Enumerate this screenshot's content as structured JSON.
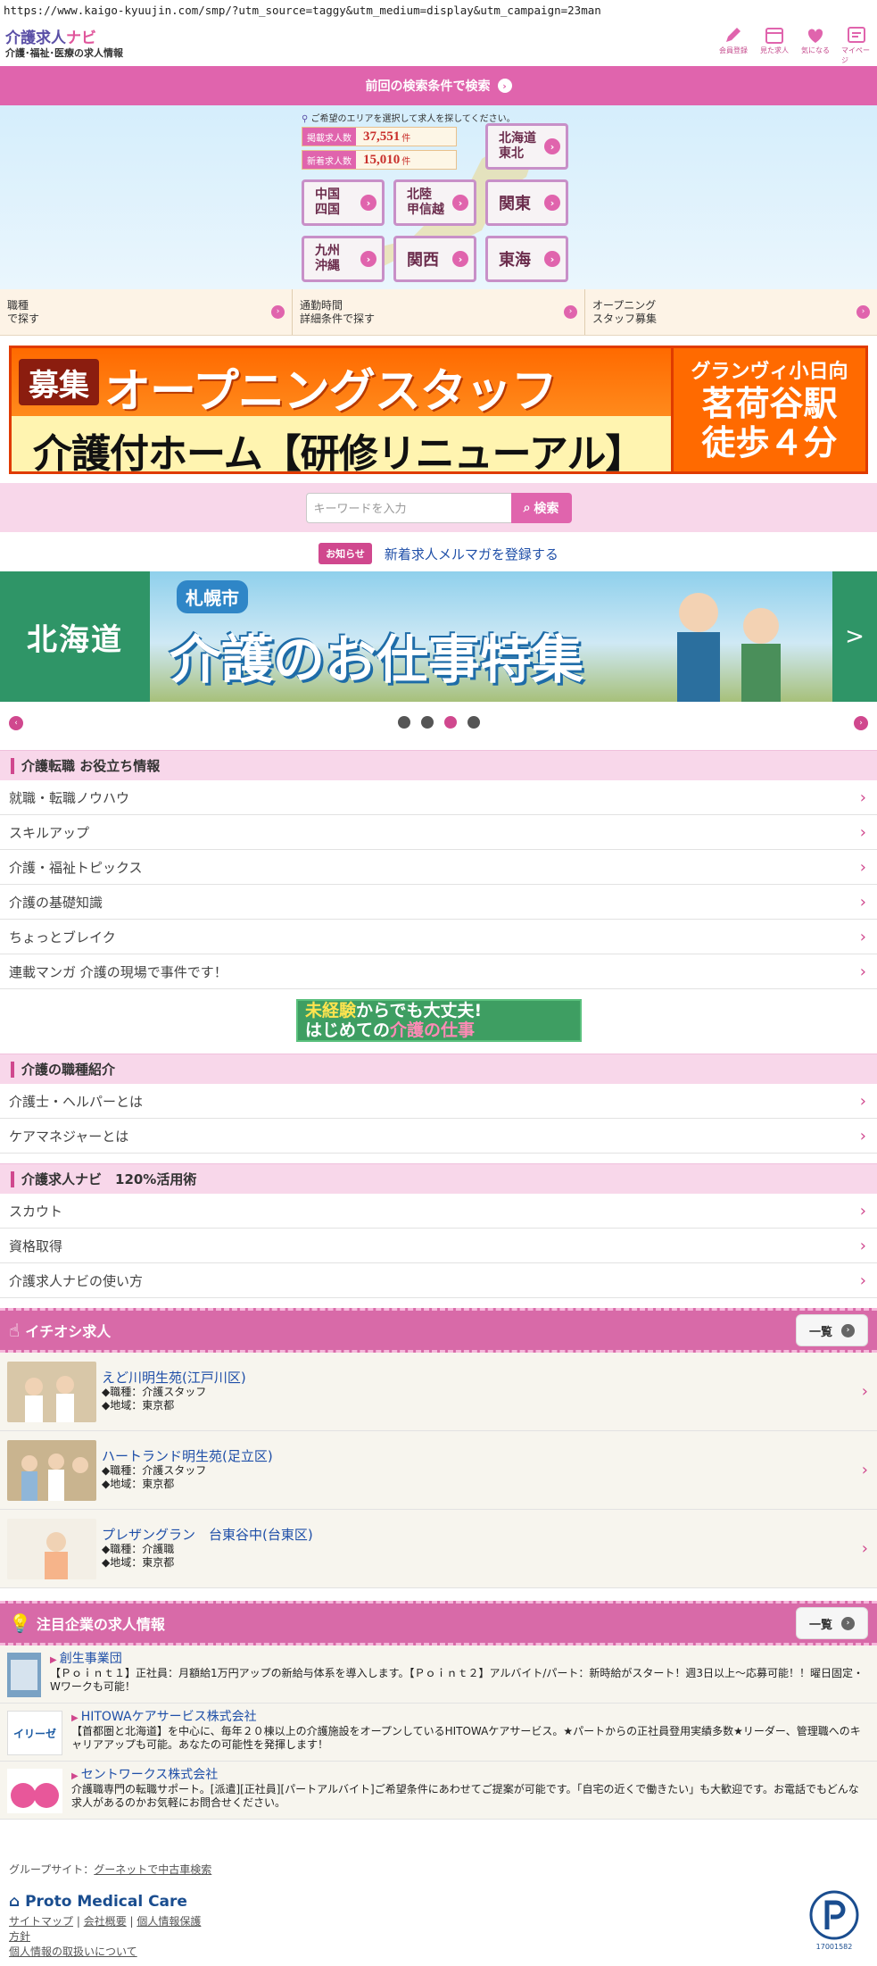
{
  "url": "https://www.kaigo-kyuujin.com/smp/?utm_source=taggy&utm_medium=display&utm_campaign=23man",
  "header": {
    "logo_title_a": "介護求人",
    "logo_title_b": "ナビ",
    "logo_sub": "介護･福祉･医療の求人情報",
    "icons": [
      {
        "name": "pencil-icon",
        "label": "会員登録"
      },
      {
        "name": "calendar-icon",
        "label": "見た求人"
      },
      {
        "name": "heart-icon",
        "label": "気になる"
      },
      {
        "name": "mypage-icon",
        "label": "マイページ"
      }
    ]
  },
  "last_search": "前回の検索条件で検索",
  "region": {
    "hint": "ご希望のエリアを選択して求人を探してください。",
    "stat1_label": "掲載求人数",
    "stat1_value": "37,551",
    "stat1_unit": "件",
    "stat2_label": "新着求人数",
    "stat2_value": "15,010",
    "stat2_unit": "件",
    "buttons": [
      "北海道\n東北",
      "中国\n四国",
      "北陸\n甲信越",
      "関東",
      "九州\n沖縄",
      "関西",
      "東海"
    ]
  },
  "tri_links": [
    "職種\nで探す",
    "通勤時間\n詳細条件で探す",
    "オープニング\nスタッフ募集"
  ],
  "banner1": {
    "boshu": "募集",
    "opening": "オープニングスタッフ",
    "home": "介護付ホーム【研修リニューアル】",
    "name": "グランヴィ小日向",
    "station": "茗荷谷駅",
    "walk": "徒歩４分"
  },
  "search": {
    "placeholder": "キーワードを入力",
    "button": "検索"
  },
  "notice": {
    "tag": "お知らせ",
    "link": "新着求人メルマガを登録する"
  },
  "slider": {
    "label": "北海道",
    "city": "札幌市",
    "title": "介護のお仕事特集",
    "next": ">"
  },
  "pager": {
    "active": 3,
    "count": 4
  },
  "section1": {
    "title": "介護転職 お役立ち情報",
    "items": [
      "就職・転職ノウハウ",
      "スキルアップ",
      "介護・福祉トピックス",
      "介護の基礎知識",
      "ちょっとブレイク",
      "連載マンガ 介護の現場で事件です！"
    ]
  },
  "mid_banner": {
    "line1a": "未経験",
    "line1b": "からでも大丈夫!",
    "line2a": "はじめての",
    "line2b": "介護の仕事"
  },
  "section2": {
    "title": "介護の職種紹介",
    "items": [
      "介護士・ヘルパーとは",
      "ケアマネジャーとは"
    ]
  },
  "section3": {
    "title": "介護求人ナビ　120%活用術",
    "items": [
      "スカウト",
      "資格取得",
      "介護求人ナビの使い方"
    ]
  },
  "ichioshi": {
    "title": "イチオシ求人",
    "list_button": "一覧",
    "jobs": [
      {
        "name": "えど川明生苑(江戸川区)",
        "job": "◆職種：介護スタッフ",
        "area": "◆地域：東京都"
      },
      {
        "name": "ハートランド明生苑(足立区)",
        "job": "◆職種：介護スタッフ",
        "area": "◆地域：東京都"
      },
      {
        "name": "プレザングラン　台東谷中(台東区)",
        "job": "◆職種：介護職",
        "area": "◆地域：東京都"
      }
    ]
  },
  "companies": {
    "title": "注目企業の求人情報",
    "list_button": "一覧",
    "items": [
      {
        "name": "創生事業団",
        "desc": "【Ｐｏｉｎｔ１】正社員：月額給1万円アップの新給与体系を導入します。【Ｐｏｉｎｔ２】アルバイト/パート：新時給がスタート！週3日以上～応募可能！！曜日固定・Wワークも可能！"
      },
      {
        "name": "HITOWAケアサービス株式会社",
        "logo": "イリーゼ",
        "desc": "【首都圏と北海道】を中心に、毎年２０棟以上の介護施設をオープンしているHITOWAケアサービス。★パートからの正社員登用実績多数★リーダー、管理職へのキャリアアップも可能。あなたの可能性を発揮します！"
      },
      {
        "name": "セントワークス株式会社",
        "desc": "介護職専門の転職サポート。[派遣][正社員][パートアルバイト]ご希望条件にあわせてご提案が可能です。「自宅の近くで働きたい」も大歓迎です。お電話でもどんな求人があるのかお気軽にお問合せください。"
      }
    ]
  },
  "footer": {
    "group_label": "グループサイト：",
    "group_link": "グーネットで中古車検索",
    "company": "Proto Medical Care",
    "links": [
      "サイトマップ",
      "会社概要",
      "個人情報保護",
      "方針"
    ],
    "privacy_link": "個人情報の取扱いについて",
    "pmark_no": "17001582"
  }
}
